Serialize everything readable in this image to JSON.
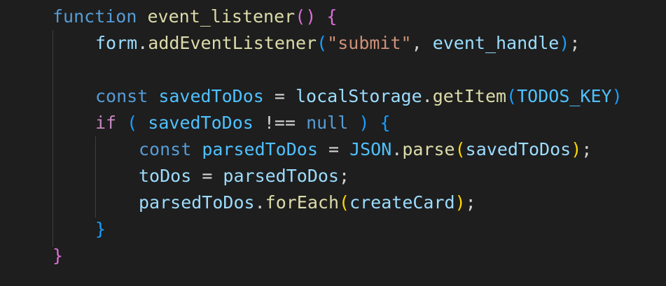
{
  "colors": {
    "background": "#1e1e1e",
    "keyword": "#569cd6",
    "control": "#c586c0",
    "function": "#dcdcaa",
    "variable": "#9cdcfe",
    "constant": "#4fc1ff",
    "string": "#ce9178",
    "plain": "#d4d4d4",
    "bracket_level_1": "#ffd700",
    "bracket_level_2": "#da70d6",
    "bracket_level_3": "#179fff"
  },
  "code": {
    "line1": {
      "t1": "function",
      "t2": " ",
      "t3": "event_listener",
      "t4": "()",
      "t5": " ",
      "t6": "{"
    },
    "line2": {
      "t1": "form",
      "t2": ".",
      "t3": "addEventListener",
      "t4": "(",
      "t5": "\"submit\"",
      "t6": ", ",
      "t7": "event_handle",
      "t8": ")",
      "t9": ";"
    },
    "line4": {
      "t1": "const",
      "t2": " ",
      "t3": "savedToDos",
      "t4": " = ",
      "t5": "localStorage",
      "t6": ".",
      "t7": "getItem",
      "t8": "(",
      "t9": "TODOS_KEY",
      "t10": ")"
    },
    "line5": {
      "t1": "if",
      "t2": " ",
      "t3": "(",
      "t4": " ",
      "t5": "savedToDos",
      "t6": " !== ",
      "t7": "null",
      "t8": " ",
      "t9": ")",
      "t10": " ",
      "t11": "{"
    },
    "line6": {
      "t1": "const",
      "t2": " ",
      "t3": "parsedToDos",
      "t4": " = ",
      "t5": "JSON",
      "t6": ".",
      "t7": "parse",
      "t8": "(",
      "t9": "savedToDos",
      "t10": ")",
      "t11": ";"
    },
    "line7": {
      "t1": "toDos",
      "t2": " = ",
      "t3": "parsedToDos",
      "t4": ";"
    },
    "line8": {
      "t1": "parsedToDos",
      "t2": ".",
      "t3": "forEach",
      "t4": "(",
      "t5": "createCard",
      "t6": ")",
      "t7": ";"
    },
    "line9": {
      "t1": "}"
    },
    "line10": {
      "t1": "}"
    }
  }
}
